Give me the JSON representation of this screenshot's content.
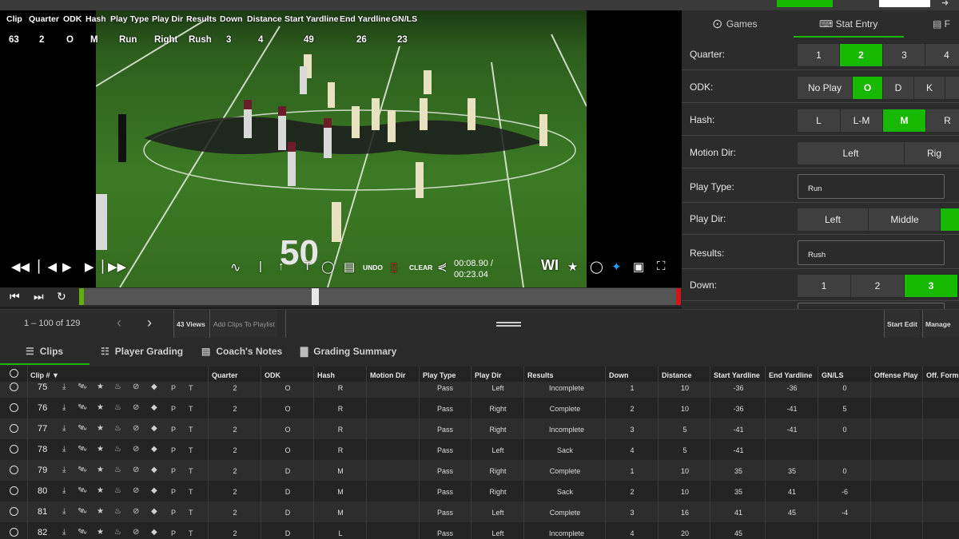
{
  "overlay": {
    "headers": [
      "Clip",
      "Quarter",
      "ODK",
      "Hash",
      "Play Type",
      "Play Dir",
      "Results",
      "Down",
      "Distance",
      "Start Yardline",
      "End Yardline",
      "GN/LS"
    ],
    "values": [
      "63",
      "2",
      "O",
      "M",
      "Run",
      "Right",
      "Rush",
      "3",
      "4",
      "49",
      "26",
      "23"
    ]
  },
  "video": {
    "undo_label": "UNDO",
    "clear_label": "CLEAR",
    "current_time": "00:08.90 /",
    "total_time": "00:23.04",
    "watermark": "WI",
    "yard_marker": "50"
  },
  "stat_panel": {
    "tabs": [
      {
        "label": "Games",
        "icon": "play-circle-icon"
      },
      {
        "label": "Stat Entry",
        "icon": "keyboard-icon"
      },
      {
        "label": "F",
        "icon": "file-icon"
      }
    ],
    "quarter": {
      "label": "Quarter:",
      "options": [
        "1",
        "2",
        "3",
        "4"
      ],
      "selected": "2"
    },
    "odk": {
      "label": "ODK:",
      "options": [
        "No Play",
        "O",
        "D",
        "K"
      ],
      "selected": "O"
    },
    "hash": {
      "label": "Hash:",
      "options": [
        "L",
        "L-M",
        "M",
        "R"
      ],
      "selected": "M"
    },
    "motion_dir": {
      "label": "Motion Dir:",
      "options": [
        "Left",
        "Rig"
      ]
    },
    "play_type": {
      "label": "Play Type:",
      "value": "Run"
    },
    "play_dir": {
      "label": "Play Dir:",
      "options": [
        "Left",
        "Middle",
        ""
      ],
      "selected_index": 2
    },
    "results": {
      "label": "Results:",
      "value": "Rush"
    },
    "down": {
      "label": "Down:",
      "options": [
        "1",
        "2",
        "3"
      ],
      "selected": "3"
    }
  },
  "pager": {
    "range": "1 – 100 of 129",
    "views": "43 Views",
    "add_to_playlist": "Add Clips To Playlist",
    "start_edit": "Start Edit",
    "manage": "Manage C"
  },
  "subtabs": [
    {
      "label": "Clips",
      "icon": "list-icon"
    },
    {
      "label": "Player Grading",
      "icon": "grading-list-icon"
    },
    {
      "label": "Coach's Notes",
      "icon": "notes-icon"
    },
    {
      "label": "Grading Summary",
      "icon": "document-icon"
    }
  ],
  "table": {
    "columns": [
      "Clip #",
      "Quarter",
      "ODK",
      "Hash",
      "Motion Dir",
      "Play Type",
      "Play Dir",
      "Results",
      "Down",
      "Distance",
      "Start Yardline",
      "End Yardline",
      "GN/LS",
      "Offense Play",
      "Off. Form"
    ],
    "row_letters": [
      "P",
      "T"
    ],
    "rows": [
      {
        "clip": "75",
        "quarter": "2",
        "odk": "O",
        "hash": "R",
        "motion": "",
        "type": "Pass",
        "dir": "Left",
        "result": "Incomplete",
        "down": "1",
        "dist": "10",
        "start": "-36",
        "end": "-36",
        "gnls": "0"
      },
      {
        "clip": "76",
        "quarter": "2",
        "odk": "O",
        "hash": "R",
        "motion": "",
        "type": "Pass",
        "dir": "Right",
        "result": "Complete",
        "down": "2",
        "dist": "10",
        "start": "-36",
        "end": "-41",
        "gnls": "5"
      },
      {
        "clip": "77",
        "quarter": "2",
        "odk": "O",
        "hash": "R",
        "motion": "",
        "type": "Pass",
        "dir": "Right",
        "result": "Incomplete",
        "down": "3",
        "dist": "5",
        "start": "-41",
        "end": "-41",
        "gnls": "0"
      },
      {
        "clip": "78",
        "quarter": "2",
        "odk": "O",
        "hash": "R",
        "motion": "",
        "type": "Pass",
        "dir": "Left",
        "result": "Sack",
        "down": "4",
        "dist": "5",
        "start": "-41",
        "end": "",
        "gnls": ""
      },
      {
        "clip": "79",
        "quarter": "2",
        "odk": "D",
        "hash": "M",
        "motion": "",
        "type": "Pass",
        "dir": "Right",
        "result": "Complete",
        "down": "1",
        "dist": "10",
        "start": "35",
        "end": "35",
        "gnls": "0"
      },
      {
        "clip": "80",
        "quarter": "2",
        "odk": "D",
        "hash": "M",
        "motion": "",
        "type": "Pass",
        "dir": "Right",
        "result": "Sack",
        "down": "2",
        "dist": "10",
        "start": "35",
        "end": "41",
        "gnls": "-6"
      },
      {
        "clip": "81",
        "quarter": "2",
        "odk": "D",
        "hash": "M",
        "motion": "",
        "type": "Pass",
        "dir": "Left",
        "result": "Complete",
        "down": "3",
        "dist": "16",
        "start": "41",
        "end": "45",
        "gnls": "-4"
      },
      {
        "clip": "82",
        "quarter": "2",
        "odk": "D",
        "hash": "L",
        "motion": "",
        "type": "Pass",
        "dir": "Left",
        "result": "Incomplete",
        "down": "4",
        "dist": "20",
        "start": "45",
        "end": "",
        "gnls": ""
      }
    ]
  },
  "colors": {
    "accent": "#17b800",
    "danger": "#d01616"
  }
}
